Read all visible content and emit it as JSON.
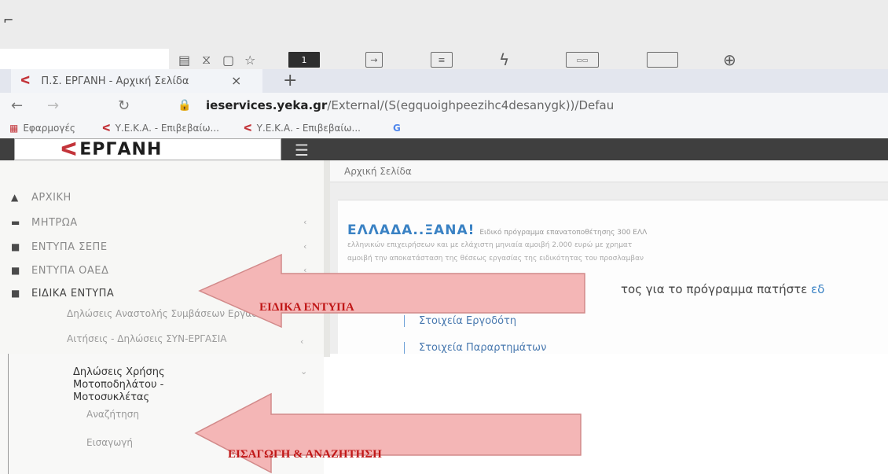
{
  "browser": {
    "toolbar_badge": "1",
    "tab": {
      "title": "Π.Σ. ΕΡΓΑΝΗ - Αρχική Σελίδα",
      "close": "×",
      "new_tab": "+"
    },
    "address": {
      "host": "ieservices.yeka.gr",
      "path": "/External/(S(egquoighpeezihc4desanygk))/Defau"
    },
    "bookmarks": [
      {
        "label": "Εφαρμογές"
      },
      {
        "label": "Υ.Ε.Κ.Α. - Επιβεβαίω..."
      },
      {
        "label": "Υ.Ε.Κ.Α. - Επιβεβαίω..."
      },
      {
        "label": "G"
      }
    ]
  },
  "app": {
    "logo": "ΕΡΓΑΝΗ"
  },
  "sidebar": {
    "items": [
      {
        "label": "ΑΡΧΙΚΗ"
      },
      {
        "label": "ΜΗΤΡΩΑ"
      },
      {
        "label": "ΕΝΤΥΠΑ ΣΕΠΕ"
      },
      {
        "label": "ΕΝΤΥΠΑ ΟΑΕΔ"
      },
      {
        "label": "ΕΙΔΙΚΑ ΕΝΤΥΠΑ"
      }
    ],
    "sub_items": [
      {
        "label": "Δηλώσεις Αναστολής Συμβάσεων Εργασίας"
      },
      {
        "label": "Αιτήσεις - Δηλώσεις ΣΥΝ-ΕΡΓΑΣΙΑ"
      },
      {
        "label": "Δηλώσεις Χρήσης Μοτοποδηλάτου - Μοτοσυκλέτας"
      }
    ],
    "leaves": [
      {
        "label": "Αναζήτηση"
      },
      {
        "label": "Εισαγωγή"
      }
    ]
  },
  "main": {
    "breadcrumb": "Αρχική Σελίδα",
    "banner_title": "ΕΛΛΑΔΑ..ΞΑΝΑ!",
    "banner_text_1": "Ειδικό πρόγραμμα επανατοποθέτησης 300 ΕΛΛ",
    "banner_text_2": "ελληνικών επιχειρήσεων και με ελάχιστη μηνιαία αμοιβή 2.000 ευρώ με χρηματ",
    "banner_text_3": "αμοιβή την αποκατάσταση της θέσεως εργασίας της ειδικότητας του προσλαμβαν",
    "program_line": "τος για το πρόγραμμα πατήστε ",
    "program_link": "εδ",
    "links": [
      {
        "label": "Στοιχεία Εργοδότη"
      },
      {
        "label": "Στοιχεία Παραρτημάτων"
      }
    ]
  },
  "annotations": {
    "arrow_1": "ΕΙΔΙΚΑ ΕΝΤΥΠΑ",
    "arrow_2": "ΕΙΣΑΓΩΓΗ  & ΑΝΑΖΗΤΗΣΗ"
  },
  "colors": {
    "brand": "#c3343a",
    "link": "#3a82c4",
    "arrow_fill": "#f4b6b6",
    "arrow_text": "#c01717"
  }
}
